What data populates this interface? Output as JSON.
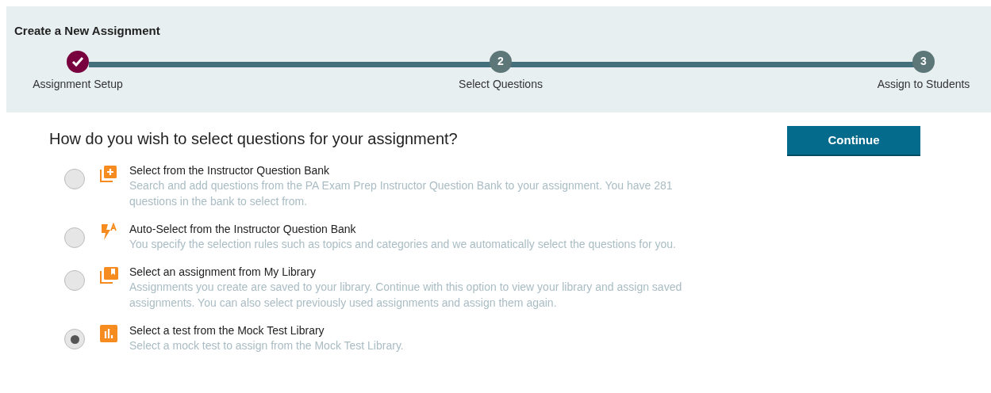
{
  "header": {
    "title": "Create a New Assignment"
  },
  "steps": [
    {
      "label": "Assignment Setup",
      "completed": true
    },
    {
      "label": "Select Questions",
      "number": "2",
      "completed": false
    },
    {
      "label": "Assign to Students",
      "number": "3",
      "completed": false
    }
  ],
  "question": "How do you wish to select questions for your assignment?",
  "continue_button": "Continue",
  "options": [
    {
      "kind": "bank",
      "title": "Select from the Instructor Question Bank",
      "description": "Search and add questions from the PA Exam Prep Instructor Question Bank to your assignment. You have 281 questions in the bank to select from.",
      "selected": false
    },
    {
      "kind": "auto",
      "title": "Auto-Select from the Instructor Question Bank",
      "description": "You specify the selection rules such as topics and categories and we automatically select the questions for you.",
      "selected": false
    },
    {
      "kind": "library",
      "title": "Select an assignment from My Library",
      "description": "Assignments you create are saved to your library. Continue with this option to view your library and assign saved assignments. You can also select previously used assignments and assign them again.",
      "selected": false
    },
    {
      "kind": "mock",
      "title": "Select a test from the Mock Test Library",
      "description": "Select a mock test to assign from the Mock Test Library.",
      "selected": true
    }
  ]
}
